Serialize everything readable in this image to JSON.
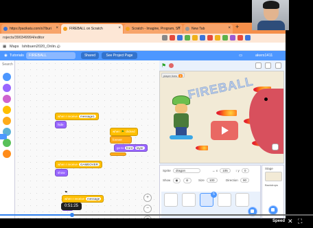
{
  "browser": {
    "tabs": [
      {
        "label": "https://pacikatu.com/s7/buri",
        "active": false,
        "fav_color": "#3b73d9"
      },
      {
        "label": "FIREBALL on Scratch",
        "active": true,
        "fav_color": "#f4a11f"
      },
      {
        "label": "Scratch - Imagine, Program, Sh",
        "active": false,
        "fav_color": "#f4a11f"
      },
      {
        "label": "New Tab",
        "active": false,
        "fav_color": "#999999"
      }
    ],
    "new_tab": "+",
    "window_controls": [
      "–",
      "□",
      "×"
    ],
    "url": "rojects/390349994/editor",
    "bookmarks": [
      "Maps",
      "Ishibuen2020_Onlin...",
      ""
    ]
  },
  "scratch": {
    "menu": {
      "tutorials": "Tutorials",
      "project_title": "FIREBALL",
      "shared": "Shared",
      "see_project": "See Project Page",
      "username": "akers1411"
    },
    "palette": {
      "search": "Search",
      "colors": [
        "#4c97ff",
        "#9966ff",
        "#cf63cf",
        "#ffbf00",
        "#ffab19",
        "#5cb1d6",
        "#59c059",
        "#ff8c1a"
      ]
    },
    "workspace": {
      "blocks": [
        {
          "text": "when I receive",
          "pill": "message1"
        },
        {
          "text": "hide",
          "pill": ""
        },
        {
          "text": "when",
          "pill": "clicked"
        },
        {
          "text": "forever",
          "pill": ""
        },
        {
          "text": "go to",
          "pill": "front"
        },
        {
          "text": "when I receive",
          "pill": "GAMEOVER"
        },
        {
          "text": "show",
          "pill": ""
        },
        {
          "text": "when I receive",
          "pill": "message"
        },
        {
          "text": "hide",
          "pill": ""
        }
      ],
      "zoom": {
        "in": "+",
        "out": "−",
        "reset": "="
      }
    },
    "stage": {
      "var_label": "player lives",
      "var_value": "3",
      "title_art": "FIREBALL"
    },
    "sprite_info": {
      "sprite_label": "Sprite",
      "sprite_name": "dragon",
      "x_label": "↔ x",
      "x_value": "105",
      "y_label": "↕ y",
      "y_value": "0",
      "show_label": "Show",
      "size_label": "Size",
      "size_value": "100",
      "direction_label": "Direction",
      "direction_value": "90"
    },
    "stage_pane": {
      "label": "Stage",
      "backdrops_label": "Backdrops"
    },
    "selected_badge": "5"
  },
  "video": {
    "timestamp": "0:51:25",
    "progress": 0.23,
    "speed_label": "Speed",
    "icons": [
      "close-icon",
      "fullscreen-icon"
    ]
  }
}
